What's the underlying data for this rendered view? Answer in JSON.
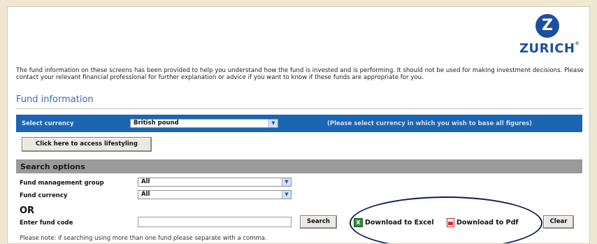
{
  "brand": {
    "name": "ZURICH",
    "mark": "Z"
  },
  "disclaimer": "The fund information on these screens has been provided to help you understand how the fund is invested and is performing. It should not be used for making investment decisions. Please contact your relevant financial professional for further explanation or advice if you want to know if these funds are appropriate for you.",
  "section_title": "Fund information",
  "currency": {
    "label": "Select currency",
    "selected": "British pound",
    "hint": "(Please select currency in which you wish to base all figures)"
  },
  "lifestyling_button": "Click here to access lifestyling",
  "search": {
    "header": "Search options",
    "management_group_label": "Fund management group",
    "management_group_value": "All",
    "fund_currency_label": "Fund currency",
    "fund_currency_value": "All",
    "or_label": "OR",
    "fund_code_label": "Enter fund code",
    "fund_code_value": "",
    "search_button": "Search",
    "download_excel": "Download to Excel",
    "download_pdf": "Download to Pdf",
    "clear_button": "Clear",
    "note": "Please note: if searching using more than one fund please separate with a comma."
  },
  "colors": {
    "accent_blue": "#1b66b4",
    "section_title": "#3a6cb8",
    "search_header": "#9a9a9a",
    "page_background": "#efe7d2",
    "highlight": "#0d1f58"
  },
  "icons": {
    "brand": "zurich-logo",
    "dropdown": "chevron-down-icon",
    "excel": "excel-icon",
    "pdf": "pdf-icon"
  }
}
